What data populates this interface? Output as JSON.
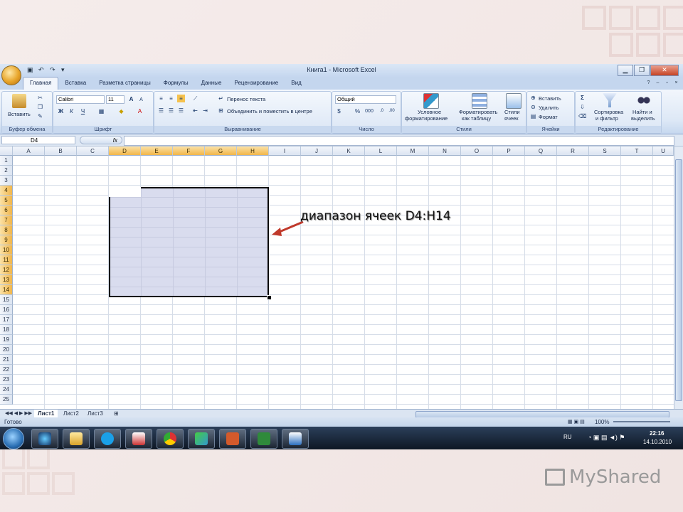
{
  "window": {
    "title": "Книга1 - Microsoft Excel",
    "buttons": [
      "▁",
      "❐",
      "✕"
    ]
  },
  "ribbon": {
    "tabs": [
      "Главная",
      "Вставка",
      "Разметка страницы",
      "Формулы",
      "Данные",
      "Рецензирование",
      "Вид"
    ],
    "clipboard": {
      "paste": "Вставить",
      "label": "Буфер обмена"
    },
    "font": {
      "name": "Calibri",
      "size": "11",
      "bold": "Ж",
      "italic": "К",
      "underline": "Ч",
      "grow": "A",
      "shrink": "A",
      "label": "Шрифт"
    },
    "alignment": {
      "wrap": "Перенос текста",
      "merge": "Объединить и поместить в центре",
      "label": "Выравнивание"
    },
    "number": {
      "format": "Общий",
      "percent": "%",
      "thousands": "000",
      "label": "Число"
    },
    "styles": {
      "conditional_1": "Условное",
      "conditional_2": "форматирование",
      "table_1": "Форматировать",
      "table_2": "как таблицу",
      "cell_1": "Стили",
      "cell_2": "ячеек",
      "label": "Стили"
    },
    "cells": {
      "insert": "Вставить",
      "delete": "Удалить",
      "format": "Формат",
      "label": "Ячейки"
    },
    "editing": {
      "sort_1": "Сортировка",
      "sort_2": "и фильтр",
      "find_1": "Найти и",
      "find_2": "выделить",
      "label": "Редактирование"
    }
  },
  "formula_bar": {
    "name_box": "D4",
    "fx": "fx",
    "value": ""
  },
  "grid": {
    "columns": [
      "A",
      "B",
      "C",
      "D",
      "E",
      "F",
      "G",
      "H",
      "I",
      "J",
      "K",
      "L",
      "M",
      "N",
      "O",
      "P",
      "Q",
      "R",
      "S",
      "T",
      "U"
    ],
    "rows": [
      "1",
      "2",
      "3",
      "4",
      "5",
      "6",
      "7",
      "8",
      "9",
      "10",
      "11",
      "12",
      "13",
      "14",
      "15",
      "16",
      "17",
      "18",
      "19",
      "20",
      "21",
      "22",
      "23",
      "24",
      "25"
    ],
    "selected_range": "D4:H14"
  },
  "sheets": [
    "Лист1",
    "Лист2",
    "Лист3"
  ],
  "status": {
    "ready": "Готово",
    "zoom": "100%"
  },
  "annotation": "диапазон ячеек D4:H14",
  "taskbar": {
    "lang": "RU",
    "time": "22:16",
    "date": "14.10.2010"
  },
  "watermark": "MyShared",
  "colors": {
    "selection": "#d9dcee",
    "header_selected": "#f1b64a",
    "ribbon": "#dde8f6",
    "taskbar": "#0e1724",
    "arrow": "#c0392b"
  }
}
